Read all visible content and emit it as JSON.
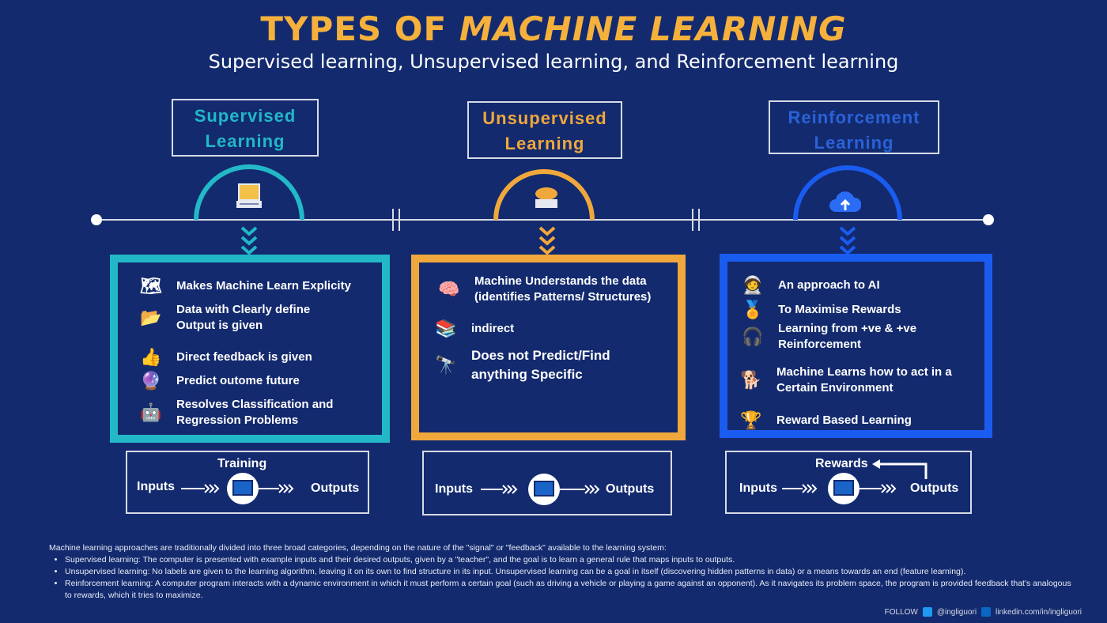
{
  "header": {
    "title_part1": "TYPES OF ",
    "title_part2": "MACHINE LEARNING",
    "subtitle": "Supervised learning, Unsupervised learning, and Reinforcement learning"
  },
  "colors": {
    "background": "#132a6e",
    "supervised": "#22b8c8",
    "unsupervised": "#f0a83c",
    "reinforcement": "#1a5cf0",
    "title": "#f5b13c"
  },
  "supervised": {
    "head_line1": "Supervised",
    "head_line2": "Learning",
    "items": [
      {
        "icon": "hand-pointer-icon",
        "line1": "Makes Machine Learn Explicity",
        "line2": ""
      },
      {
        "icon": "folder-icon",
        "line1": "Data with Clearly define",
        "line2": "Output is given"
      },
      {
        "icon": "thumbs-up-icon",
        "line1": "Direct feedback is given",
        "line2": ""
      },
      {
        "icon": "crystal-ball-icon",
        "line1": "Predict outome future",
        "line2": ""
      },
      {
        "icon": "robot-icon",
        "line1": "Resolves Classification and",
        "line2": "Regression Problems"
      }
    ],
    "flow": {
      "top_label": "Training",
      "inputs": "Inputs",
      "outputs": "Outputs"
    }
  },
  "unsupervised": {
    "head_line1": "Unsupervised",
    "head_line2": "Learning",
    "items": [
      {
        "icon": "brain-chip-icon",
        "line1": "Machine Understands the data",
        "line2": "(identifies Patterns/ Structures)"
      },
      {
        "icon": "books-icon",
        "line1": "indirect",
        "line2": ""
      },
      {
        "icon": "binoculars-icon",
        "line1": "Does not Predict/Find",
        "line2": " anything Specific"
      }
    ],
    "flow": {
      "inputs": "Inputs",
      "outputs": "Outputs"
    }
  },
  "reinforcement": {
    "head_line1": "Reinforcement",
    "head_line2": "Learning",
    "items": [
      {
        "icon": "astronaut-icon",
        "line1": "An approach to AI",
        "line2": ""
      },
      {
        "icon": "medal-icon",
        "line1": "To Maximise Rewards",
        "line2": ""
      },
      {
        "icon": "headset-icon",
        "line1": "Learning from +ve & +ve",
        "line2": " Reinforcement"
      },
      {
        "icon": "robot-dog-icon",
        "line1": "Machine Learns how to act in a",
        "line2": "Certain Environment"
      },
      {
        "icon": "trophy-icon",
        "line1": "Reward Based Learning",
        "line2": ""
      }
    ],
    "flow": {
      "top_label": "Rewards",
      "inputs": "Inputs",
      "outputs": "Outputs"
    }
  },
  "footer": {
    "intro": "Machine learning approaches are traditionally divided into three broad categories, depending on the nature of the \"signal\" or \"feedback\" available to the learning system:",
    "bullets": [
      "Supervised learning: The computer is presented with example inputs and their desired outputs, given by a \"teacher\", and the goal is to learn a general rule that maps inputs to outputs.",
      "Unsupervised learning: No labels are given to the learning algorithm, leaving it on its own to find structure in its input. Unsupervised learning can be a goal in itself (discovering hidden patterns in data) or a means towards an end (feature learning).",
      "Reinforcement learning: A computer program interacts with a dynamic environment in which it must perform a certain goal (such as driving a vehicle or playing a game against an opponent). As it navigates its problem space, the program is provided feedback that's analogous to rewards, which it tries to maximize."
    ],
    "follow_label": "FOLLOW",
    "twitter": "@ingliguori",
    "linkedin": "linkedin.com/in/ingliguori"
  }
}
